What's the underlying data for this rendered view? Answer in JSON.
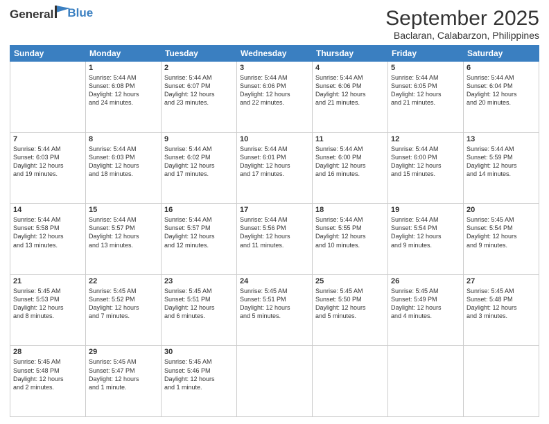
{
  "logo": {
    "line1": "General",
    "line2": "Blue"
  },
  "title": "September 2025",
  "subtitle": "Baclaran, Calabarzon, Philippines",
  "days": [
    "Sunday",
    "Monday",
    "Tuesday",
    "Wednesday",
    "Thursday",
    "Friday",
    "Saturday"
  ],
  "weeks": [
    [
      {
        "day": "",
        "info": ""
      },
      {
        "day": "1",
        "info": "Sunrise: 5:44 AM\nSunset: 6:08 PM\nDaylight: 12 hours\nand 24 minutes."
      },
      {
        "day": "2",
        "info": "Sunrise: 5:44 AM\nSunset: 6:07 PM\nDaylight: 12 hours\nand 23 minutes."
      },
      {
        "day": "3",
        "info": "Sunrise: 5:44 AM\nSunset: 6:06 PM\nDaylight: 12 hours\nand 22 minutes."
      },
      {
        "day": "4",
        "info": "Sunrise: 5:44 AM\nSunset: 6:06 PM\nDaylight: 12 hours\nand 21 minutes."
      },
      {
        "day": "5",
        "info": "Sunrise: 5:44 AM\nSunset: 6:05 PM\nDaylight: 12 hours\nand 21 minutes."
      },
      {
        "day": "6",
        "info": "Sunrise: 5:44 AM\nSunset: 6:04 PM\nDaylight: 12 hours\nand 20 minutes."
      }
    ],
    [
      {
        "day": "7",
        "info": "Sunrise: 5:44 AM\nSunset: 6:03 PM\nDaylight: 12 hours\nand 19 minutes."
      },
      {
        "day": "8",
        "info": "Sunrise: 5:44 AM\nSunset: 6:03 PM\nDaylight: 12 hours\nand 18 minutes."
      },
      {
        "day": "9",
        "info": "Sunrise: 5:44 AM\nSunset: 6:02 PM\nDaylight: 12 hours\nand 17 minutes."
      },
      {
        "day": "10",
        "info": "Sunrise: 5:44 AM\nSunset: 6:01 PM\nDaylight: 12 hours\nand 17 minutes."
      },
      {
        "day": "11",
        "info": "Sunrise: 5:44 AM\nSunset: 6:00 PM\nDaylight: 12 hours\nand 16 minutes."
      },
      {
        "day": "12",
        "info": "Sunrise: 5:44 AM\nSunset: 6:00 PM\nDaylight: 12 hours\nand 15 minutes."
      },
      {
        "day": "13",
        "info": "Sunrise: 5:44 AM\nSunset: 5:59 PM\nDaylight: 12 hours\nand 14 minutes."
      }
    ],
    [
      {
        "day": "14",
        "info": "Sunrise: 5:44 AM\nSunset: 5:58 PM\nDaylight: 12 hours\nand 13 minutes."
      },
      {
        "day": "15",
        "info": "Sunrise: 5:44 AM\nSunset: 5:57 PM\nDaylight: 12 hours\nand 13 minutes."
      },
      {
        "day": "16",
        "info": "Sunrise: 5:44 AM\nSunset: 5:57 PM\nDaylight: 12 hours\nand 12 minutes."
      },
      {
        "day": "17",
        "info": "Sunrise: 5:44 AM\nSunset: 5:56 PM\nDaylight: 12 hours\nand 11 minutes."
      },
      {
        "day": "18",
        "info": "Sunrise: 5:44 AM\nSunset: 5:55 PM\nDaylight: 12 hours\nand 10 minutes."
      },
      {
        "day": "19",
        "info": "Sunrise: 5:44 AM\nSunset: 5:54 PM\nDaylight: 12 hours\nand 9 minutes."
      },
      {
        "day": "20",
        "info": "Sunrise: 5:45 AM\nSunset: 5:54 PM\nDaylight: 12 hours\nand 9 minutes."
      }
    ],
    [
      {
        "day": "21",
        "info": "Sunrise: 5:45 AM\nSunset: 5:53 PM\nDaylight: 12 hours\nand 8 minutes."
      },
      {
        "day": "22",
        "info": "Sunrise: 5:45 AM\nSunset: 5:52 PM\nDaylight: 12 hours\nand 7 minutes."
      },
      {
        "day": "23",
        "info": "Sunrise: 5:45 AM\nSunset: 5:51 PM\nDaylight: 12 hours\nand 6 minutes."
      },
      {
        "day": "24",
        "info": "Sunrise: 5:45 AM\nSunset: 5:51 PM\nDaylight: 12 hours\nand 5 minutes."
      },
      {
        "day": "25",
        "info": "Sunrise: 5:45 AM\nSunset: 5:50 PM\nDaylight: 12 hours\nand 5 minutes."
      },
      {
        "day": "26",
        "info": "Sunrise: 5:45 AM\nSunset: 5:49 PM\nDaylight: 12 hours\nand 4 minutes."
      },
      {
        "day": "27",
        "info": "Sunrise: 5:45 AM\nSunset: 5:48 PM\nDaylight: 12 hours\nand 3 minutes."
      }
    ],
    [
      {
        "day": "28",
        "info": "Sunrise: 5:45 AM\nSunset: 5:48 PM\nDaylight: 12 hours\nand 2 minutes."
      },
      {
        "day": "29",
        "info": "Sunrise: 5:45 AM\nSunset: 5:47 PM\nDaylight: 12 hours\nand 1 minute."
      },
      {
        "day": "30",
        "info": "Sunrise: 5:45 AM\nSunset: 5:46 PM\nDaylight: 12 hours\nand 1 minute."
      },
      {
        "day": "",
        "info": ""
      },
      {
        "day": "",
        "info": ""
      },
      {
        "day": "",
        "info": ""
      },
      {
        "day": "",
        "info": ""
      }
    ]
  ]
}
